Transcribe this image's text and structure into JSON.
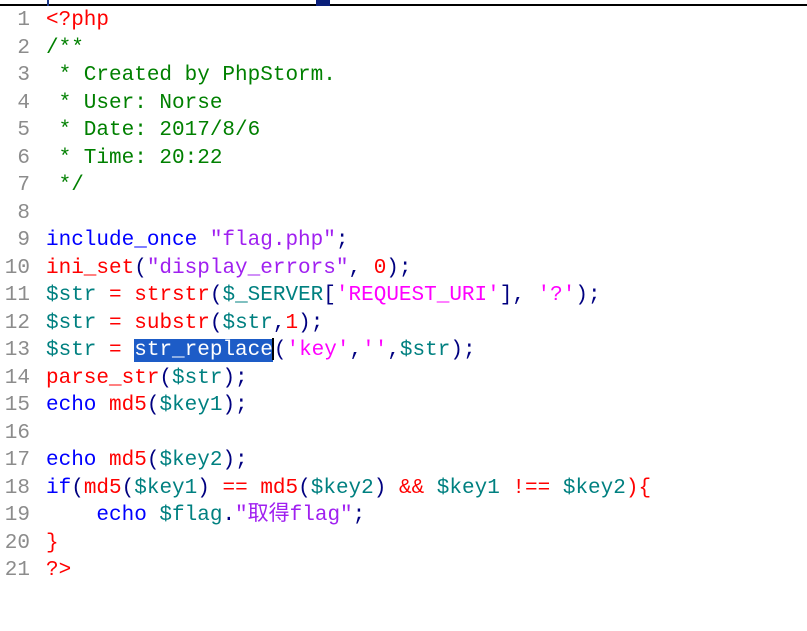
{
  "editor": {
    "lines": [
      {
        "n": "1",
        "tokens": [
          {
            "t": "<?php",
            "c": "c-php"
          }
        ]
      },
      {
        "n": "2",
        "tokens": [
          {
            "t": "/**",
            "c": "c-comment"
          }
        ]
      },
      {
        "n": "3",
        "tokens": [
          {
            "t": " * Created by PhpStorm.",
            "c": "c-comment"
          }
        ]
      },
      {
        "n": "4",
        "tokens": [
          {
            "t": " * User: Norse",
            "c": "c-comment"
          }
        ]
      },
      {
        "n": "5",
        "tokens": [
          {
            "t": " * Date: 2017/8/6",
            "c": "c-comment"
          }
        ]
      },
      {
        "n": "6",
        "tokens": [
          {
            "t": " * Time: 20:22",
            "c": "c-comment"
          }
        ]
      },
      {
        "n": "7",
        "tokens": [
          {
            "t": " */",
            "c": "c-comment"
          }
        ]
      },
      {
        "n": "8",
        "tokens": []
      },
      {
        "n": "9",
        "tokens": [
          {
            "t": "include_once ",
            "c": "c-kw"
          },
          {
            "t": "\"flag.php\"",
            "c": "c-str"
          },
          {
            "t": ";",
            "c": "c-punc"
          }
        ]
      },
      {
        "n": "10",
        "tokens": [
          {
            "t": "ini_set",
            "c": "c-fn"
          },
          {
            "t": "(",
            "c": "c-punc"
          },
          {
            "t": "\"display_errors\"",
            "c": "c-str"
          },
          {
            "t": ", ",
            "c": "c-punc"
          },
          {
            "t": "0",
            "c": "c-num"
          },
          {
            "t": ");",
            "c": "c-punc"
          }
        ]
      },
      {
        "n": "11",
        "tokens": [
          {
            "t": "$str",
            "c": "c-var"
          },
          {
            "t": " = ",
            "c": "c-op"
          },
          {
            "t": "strstr",
            "c": "c-fn"
          },
          {
            "t": "(",
            "c": "c-punc"
          },
          {
            "t": "$_SERVER",
            "c": "c-var"
          },
          {
            "t": "[",
            "c": "c-punc"
          },
          {
            "t": "'REQUEST_URI'",
            "c": "c-strmag"
          },
          {
            "t": "], ",
            "c": "c-punc"
          },
          {
            "t": "'?'",
            "c": "c-strmag"
          },
          {
            "t": ");",
            "c": "c-punc"
          }
        ]
      },
      {
        "n": "12",
        "tokens": [
          {
            "t": "$str",
            "c": "c-var"
          },
          {
            "t": " = ",
            "c": "c-op"
          },
          {
            "t": "substr",
            "c": "c-fn"
          },
          {
            "t": "(",
            "c": "c-punc"
          },
          {
            "t": "$str",
            "c": "c-var"
          },
          {
            "t": ",",
            "c": "c-punc"
          },
          {
            "t": "1",
            "c": "c-num"
          },
          {
            "t": ");",
            "c": "c-punc"
          }
        ]
      },
      {
        "n": "13",
        "tokens": [
          {
            "t": "$str",
            "c": "c-var"
          },
          {
            "t": " = ",
            "c": "c-op"
          },
          {
            "t": "str_replace",
            "c": "sel"
          },
          {
            "t": "CARET",
            "c": "caret"
          },
          {
            "t": "(",
            "c": "c-punc"
          },
          {
            "t": "'key'",
            "c": "c-strmag"
          },
          {
            "t": ",",
            "c": "c-punc"
          },
          {
            "t": "''",
            "c": "c-strmag"
          },
          {
            "t": ",",
            "c": "c-punc"
          },
          {
            "t": "$str",
            "c": "c-var"
          },
          {
            "t": ");",
            "c": "c-punc"
          }
        ]
      },
      {
        "n": "14",
        "tokens": [
          {
            "t": "parse_str",
            "c": "c-fn"
          },
          {
            "t": "(",
            "c": "c-punc"
          },
          {
            "t": "$str",
            "c": "c-var"
          },
          {
            "t": ");",
            "c": "c-punc"
          }
        ]
      },
      {
        "n": "15",
        "tokens": [
          {
            "t": "echo ",
            "c": "c-kw"
          },
          {
            "t": "md5",
            "c": "c-fn"
          },
          {
            "t": "(",
            "c": "c-punc"
          },
          {
            "t": "$key1",
            "c": "c-var"
          },
          {
            "t": ");",
            "c": "c-punc"
          }
        ]
      },
      {
        "n": "16",
        "tokens": []
      },
      {
        "n": "17",
        "tokens": [
          {
            "t": "echo ",
            "c": "c-kw"
          },
          {
            "t": "md5",
            "c": "c-fn"
          },
          {
            "t": "(",
            "c": "c-punc"
          },
          {
            "t": "$key2",
            "c": "c-var"
          },
          {
            "t": ");",
            "c": "c-punc"
          }
        ]
      },
      {
        "n": "18",
        "tokens": [
          {
            "t": "if",
            "c": "c-kw"
          },
          {
            "t": "(",
            "c": "c-punc"
          },
          {
            "t": "md5",
            "c": "c-fn"
          },
          {
            "t": "(",
            "c": "c-punc"
          },
          {
            "t": "$key1",
            "c": "c-var"
          },
          {
            "t": ") ",
            "c": "c-punc"
          },
          {
            "t": "==",
            "c": "c-op"
          },
          {
            "t": " ",
            "c": "c-punc"
          },
          {
            "t": "md5",
            "c": "c-fn"
          },
          {
            "t": "(",
            "c": "c-punc"
          },
          {
            "t": "$key2",
            "c": "c-var"
          },
          {
            "t": ") ",
            "c": "c-punc"
          },
          {
            "t": "&&",
            "c": "c-op"
          },
          {
            "t": " ",
            "c": "c-punc"
          },
          {
            "t": "$key1",
            "c": "c-var"
          },
          {
            "t": " ",
            "c": "c-punc"
          },
          {
            "t": "!==",
            "c": "c-op"
          },
          {
            "t": " ",
            "c": "c-punc"
          },
          {
            "t": "$key2",
            "c": "c-var"
          },
          {
            "t": "){",
            "c": "c-fn"
          }
        ]
      },
      {
        "n": "19",
        "tokens": [
          {
            "t": "    echo ",
            "c": "c-kw"
          },
          {
            "t": "$flag",
            "c": "c-var"
          },
          {
            "t": ".",
            "c": "c-punc"
          },
          {
            "t": "\"取得flag\"",
            "c": "c-str"
          },
          {
            "t": ";",
            "c": "c-punc"
          }
        ]
      },
      {
        "n": "20",
        "tokens": [
          {
            "t": "}",
            "c": "c-fn"
          }
        ]
      },
      {
        "n": "21",
        "tokens": [
          {
            "t": "?>",
            "c": "c-php"
          }
        ]
      }
    ]
  },
  "colors": {
    "selection": "#1d5cc7",
    "line_number": "#8c8c8c",
    "comment": "#008000",
    "keyword": "#0000ff",
    "function": "#ff0000",
    "string": "#a020f0",
    "variable": "#008080"
  }
}
